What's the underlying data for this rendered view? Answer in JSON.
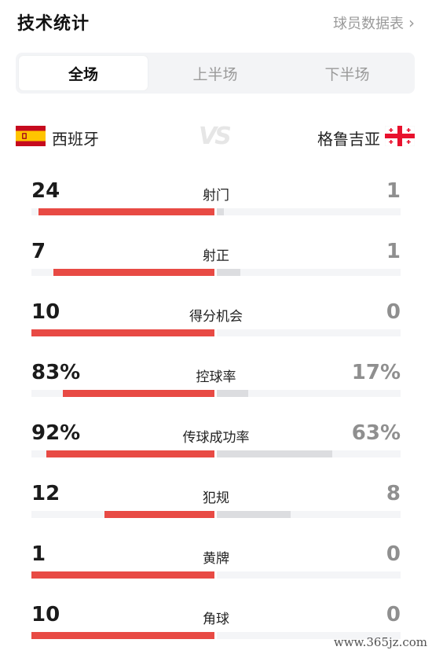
{
  "header": {
    "title": "技术统计",
    "more_label": "球员数据表"
  },
  "tabs": [
    {
      "label": "全场",
      "active": true
    },
    {
      "label": "上半场",
      "active": false
    },
    {
      "label": "下半场",
      "active": false
    }
  ],
  "teams": {
    "home": {
      "name": "西班牙",
      "flag": "spain-flag"
    },
    "away": {
      "name": "格鲁吉亚",
      "flag": "georgia-flag"
    },
    "vs_label": "VS"
  },
  "colors": {
    "home_bar": "#e84a44",
    "away_bar": "#dcdde0",
    "track": "#f4f5f7"
  },
  "stats": [
    {
      "label": "射门",
      "home": "24",
      "away": "1",
      "home_ratio": 0.96,
      "away_ratio": 0.04
    },
    {
      "label": "射正",
      "home": "7",
      "away": "1",
      "home_ratio": 0.88,
      "away_ratio": 0.13
    },
    {
      "label": "得分机会",
      "home": "10",
      "away": "0",
      "home_ratio": 1.0,
      "away_ratio": 0.0
    },
    {
      "label": "控球率",
      "home": "83%",
      "away": "17%",
      "home_ratio": 0.83,
      "away_ratio": 0.17
    },
    {
      "label": "传球成功率",
      "home": "92%",
      "away": "63%",
      "home_ratio": 0.92,
      "away_ratio": 0.63
    },
    {
      "label": "犯规",
      "home": "12",
      "away": "8",
      "home_ratio": 0.6,
      "away_ratio": 0.4
    },
    {
      "label": "黄牌",
      "home": "1",
      "away": "0",
      "home_ratio": 1.0,
      "away_ratio": 0.0
    },
    {
      "label": "角球",
      "home": "10",
      "away": "0",
      "home_ratio": 1.0,
      "away_ratio": 0.0
    }
  ],
  "watermark": "www.365jz.com"
}
